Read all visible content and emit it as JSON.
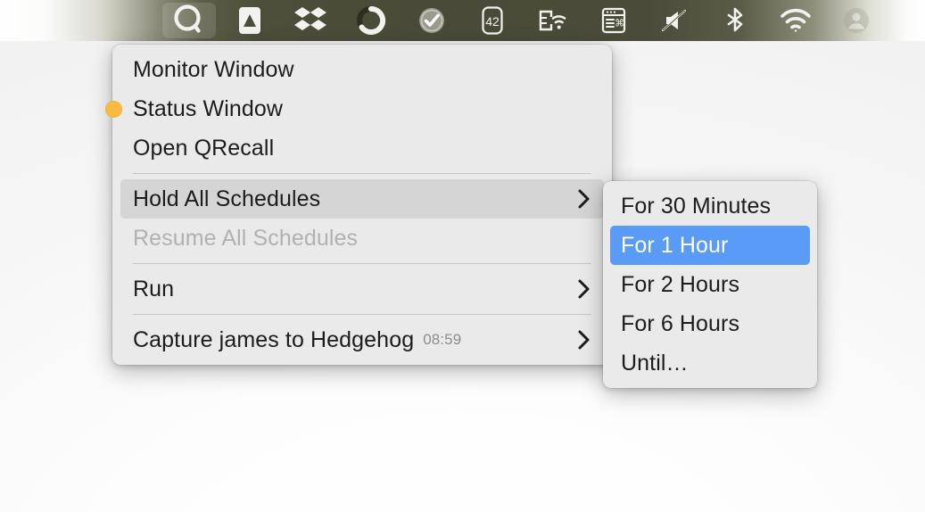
{
  "menubar": {
    "icons": [
      {
        "name": "qrecall-search-icon",
        "glyph": "Q",
        "active": true
      },
      {
        "name": "arq-backup-icon",
        "glyph": "triangle-in-square",
        "active": false
      },
      {
        "name": "dropbox-icon",
        "glyph": "dropbox",
        "active": false
      },
      {
        "name": "crescent-progress-icon",
        "glyph": "crescent",
        "active": false
      },
      {
        "name": "checkmark-circle-icon",
        "glyph": "check-circle",
        "active": false
      },
      {
        "name": "counter-42-icon",
        "glyph": "42",
        "label": "42",
        "active": false
      },
      {
        "name": "screen-sharing-icon",
        "glyph": "screen-wifi",
        "active": false
      },
      {
        "name": "keyboard-shortcuts-icon",
        "glyph": "window-command",
        "active": false
      },
      {
        "name": "volume-muted-icon",
        "glyph": "speaker-slash",
        "active": false
      },
      {
        "name": "bluetooth-icon",
        "glyph": "bluetooth",
        "active": false
      },
      {
        "name": "wifi-icon",
        "glyph": "wifi",
        "active": false
      },
      {
        "name": "control-center-user-icon",
        "glyph": "user-circle",
        "active": false
      }
    ]
  },
  "main_menu": {
    "items": [
      {
        "label": "Monitor Window",
        "bullet": false,
        "submenu": false,
        "state": "normal"
      },
      {
        "label": "Status Window",
        "bullet": true,
        "submenu": false,
        "state": "normal"
      },
      {
        "label": "Open QRecall",
        "bullet": false,
        "submenu": false,
        "state": "normal"
      },
      {
        "separator": true
      },
      {
        "label": "Hold All Schedules",
        "bullet": false,
        "submenu": true,
        "state": "highlighted"
      },
      {
        "label": "Resume All Schedules",
        "bullet": false,
        "submenu": false,
        "state": "disabled"
      },
      {
        "separator": true
      },
      {
        "label": "Run",
        "bullet": false,
        "submenu": true,
        "state": "normal"
      },
      {
        "separator": true
      },
      {
        "label": "Capture james to Hedgehog",
        "time": "08:59",
        "bullet": false,
        "submenu": true,
        "state": "normal"
      }
    ]
  },
  "sub_menu": {
    "items": [
      {
        "label": "For 30 Minutes",
        "state": "normal"
      },
      {
        "label": "For 1 Hour",
        "state": "selected"
      },
      {
        "label": "For 2 Hours",
        "state": "normal"
      },
      {
        "label": "For 6 Hours",
        "state": "normal"
      },
      {
        "label": "Until…",
        "state": "normal"
      }
    ]
  },
  "colors": {
    "menu_background": "#eaeaea",
    "highlight_gray": "#d5d5d5",
    "highlight_blue": "#5b9bf8",
    "status_dot": "#f7b93e",
    "menubar_dark": "#494b38",
    "disabled_text": "#b1b1b1",
    "time_text": "#8c8c8c"
  }
}
